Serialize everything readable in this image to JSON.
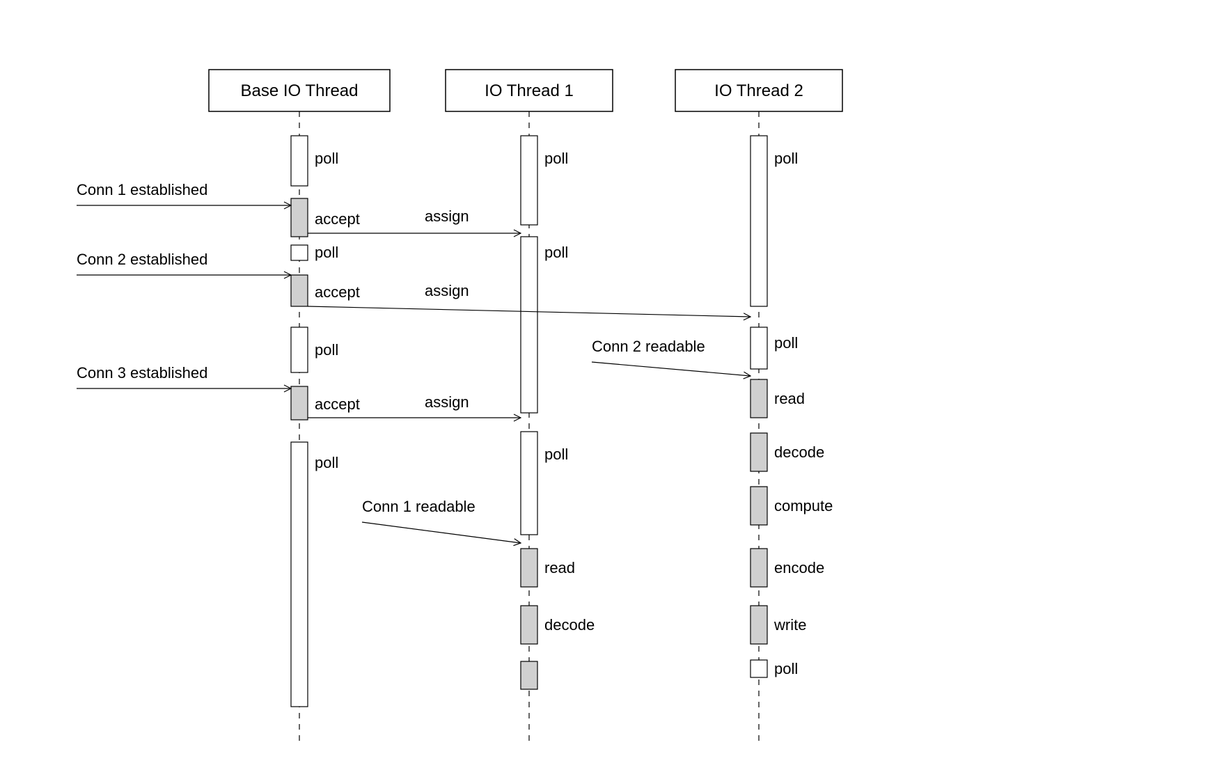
{
  "lanes": {
    "base": {
      "title": "Base IO Thread"
    },
    "io1": {
      "title": "IO Thread 1"
    },
    "io2": {
      "title": "IO Thread 2"
    }
  },
  "messages": {
    "conn1_est": "Conn 1 established",
    "conn2_est": "Conn 2 established",
    "conn3_est": "Conn 3 established",
    "assign1": "assign",
    "assign2": "assign",
    "assign3": "assign",
    "conn2_rd": "Conn 2 readable",
    "conn1_rd": "Conn 1 readable"
  },
  "labels": {
    "poll": "poll",
    "accept": "accept",
    "read": "read",
    "decode": "decode",
    "compute": "compute",
    "encode": "encode",
    "write": "write"
  }
}
